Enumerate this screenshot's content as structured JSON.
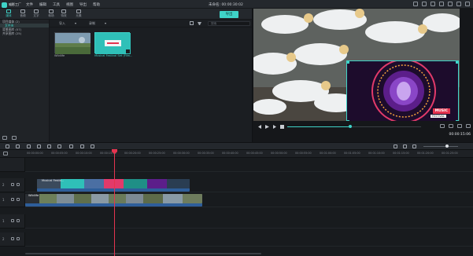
{
  "app": {
    "logo_text": "喵影工厂",
    "menu": [
      "文件",
      "编辑",
      "工具",
      "视图",
      "导出",
      "帮助"
    ],
    "project_title": "未命名: 00:00:30:02",
    "export_label": "导出"
  },
  "tabs": [
    {
      "label": "媒体",
      "icon": "media-icon"
    },
    {
      "label": "音频",
      "icon": "music-icon"
    },
    {
      "label": "文字",
      "icon": "text-icon"
    },
    {
      "label": "转场",
      "icon": "transition-icon"
    },
    {
      "label": "特效",
      "icon": "effects-icon"
    },
    {
      "label": "元素",
      "icon": "elements-icon"
    },
    {
      "label": "分屏",
      "icon": "split-icon"
    }
  ],
  "library": {
    "items": [
      {
        "label": "项目媒体 (2)",
        "selected": false
      },
      {
        "label": "文件夹",
        "selected": true
      },
      {
        "label": "背景图库 (57)",
        "selected": false
      },
      {
        "label": "共享图库 (25)",
        "selected": false
      }
    ]
  },
  "media": {
    "import_label": "导入",
    "record_label": "录制",
    "search_placeholder": "搜索",
    "thumbnails": [
      {
        "caption": "Wildlife",
        "selected": false
      },
      {
        "caption": "Musical Festival Set (Film...",
        "selected": true
      }
    ]
  },
  "preview": {
    "timecode": "00:00:15:06",
    "music_tag": "MUSIC",
    "music_subtag": "FESTIVAL",
    "progress": 0.47
  },
  "timeline": {
    "ruler_labels": [
      "00:00:00:00",
      "00:00:05:00",
      "00:00:10:00",
      "00:00:15:00",
      "00:00:20:00",
      "00:00:25:00",
      "00:00:30:00",
      "00:00:35:00",
      "00:00:40:00",
      "00:00:45:00",
      "00:00:50:00",
      "00:00:55:00",
      "00:01:00:00",
      "00:01:05:00",
      "00:01:10:00",
      "00:01:15:00",
      "00:01:20:00",
      "00:01:25:00"
    ],
    "tracks": [
      {
        "number": "2"
      },
      {
        "number": "1"
      },
      {
        "number": "1"
      },
      {
        "number": "2"
      }
    ],
    "clip_title_label": "Musical Festiv...",
    "clip_wildlife_label": "Wildlife",
    "playhead_time": "00:00:15:06"
  },
  "colors": {
    "accent": "#3fd3c8",
    "playhead": "#e5344f"
  }
}
